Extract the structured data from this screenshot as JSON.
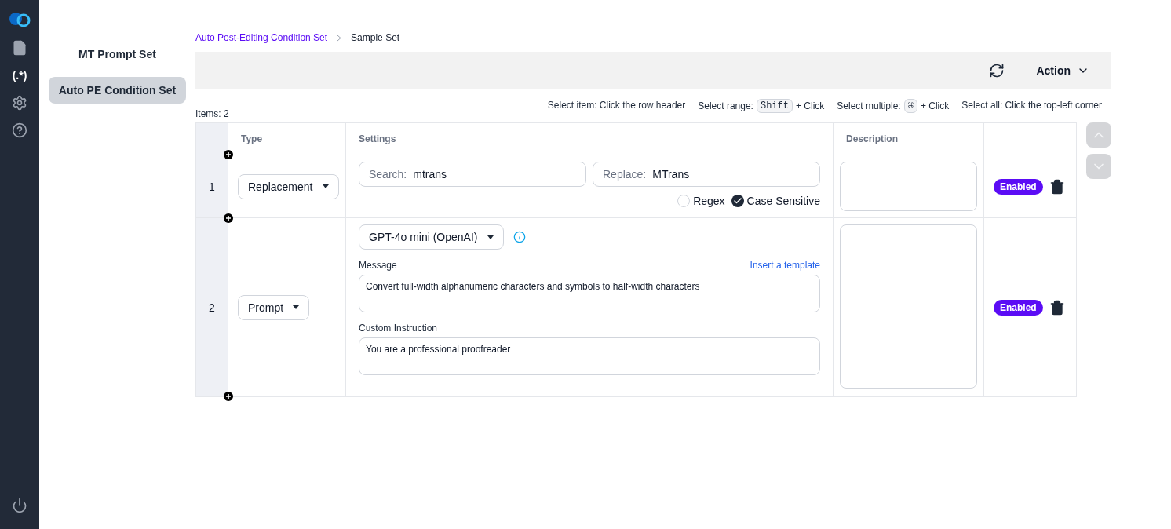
{
  "rail": {
    "items": [
      {
        "kind": "document",
        "selected": false
      },
      {
        "kind": "regex",
        "label": "(.*)",
        "selected": true
      },
      {
        "kind": "settings",
        "selected": false
      },
      {
        "kind": "help",
        "selected": false
      }
    ]
  },
  "nav": [
    {
      "label": "MT Prompt Set",
      "selected": false
    },
    {
      "label": "Auto PE Condition Set",
      "selected": true
    }
  ],
  "breadcrumb": [
    "Auto Post-Editing Condition Set",
    "Sample Set"
  ],
  "toolbar": {
    "action": "Action"
  },
  "items_count": "Items: 2",
  "hints": [
    {
      "label": "Select item: Click the row header"
    },
    {
      "label": "Select range:",
      "key": "Shift",
      "suffix": "+ Click"
    },
    {
      "label": "Select multiple:",
      "key": "⌘",
      "suffix": "+ Click"
    },
    {
      "label": "Select all: Click the top-left corner"
    }
  ],
  "table": {
    "columns": [
      "Type",
      "Settings",
      "Description"
    ],
    "rows": [
      {
        "number": "1",
        "type": "Replacement",
        "kind": "replacement",
        "search_label": "Search:",
        "search": "mtrans",
        "replace_label": "Replace:",
        "replace": "MTrans",
        "options": [
          {
            "label": "Regex",
            "checked": false
          },
          {
            "label": "Case Sensitive",
            "checked": true
          }
        ],
        "status": "Enabled",
        "enabled": true
      },
      {
        "number": "2",
        "type": "Prompt",
        "kind": "prompt",
        "model": "GPT-4o mini (OpenAI)",
        "message_label": "Message",
        "insert_link": "Insert a template",
        "message": "Convert full-width alphanumeric characters and symbols to half-width characters",
        "instruction_label": "Custom Instruction",
        "instruction": "You are a professional proofreader",
        "status": "Enabled",
        "enabled": true
      }
    ]
  }
}
